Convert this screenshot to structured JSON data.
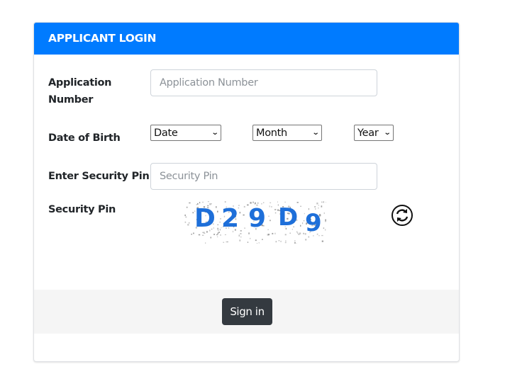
{
  "login_card": {
    "title": "APPLICANT LOGIN",
    "application_number": {
      "label_line1": "Application",
      "label_line2": "Number",
      "placeholder": "Application Number",
      "value": ""
    },
    "date_of_birth": {
      "label": "Date of Birth",
      "date_select": "Date",
      "month_select": "Month",
      "year_select": "Year"
    },
    "enter_security_pin": {
      "label": "Enter Security Pin",
      "placeholder": "Security Pin",
      "value": ""
    },
    "security_pin": {
      "label": "Security Pin",
      "captcha_text": "D29D9",
      "captcha_chars": [
        "D",
        "2",
        "9",
        "D",
        "9"
      ],
      "refresh_icon": "refresh-icon"
    },
    "sign_in_label": "Sign in"
  },
  "colors": {
    "header": "#007bff",
    "captcha_text": "#1e6fd9",
    "button": "#343a40",
    "footer": "#f5f5f5"
  }
}
